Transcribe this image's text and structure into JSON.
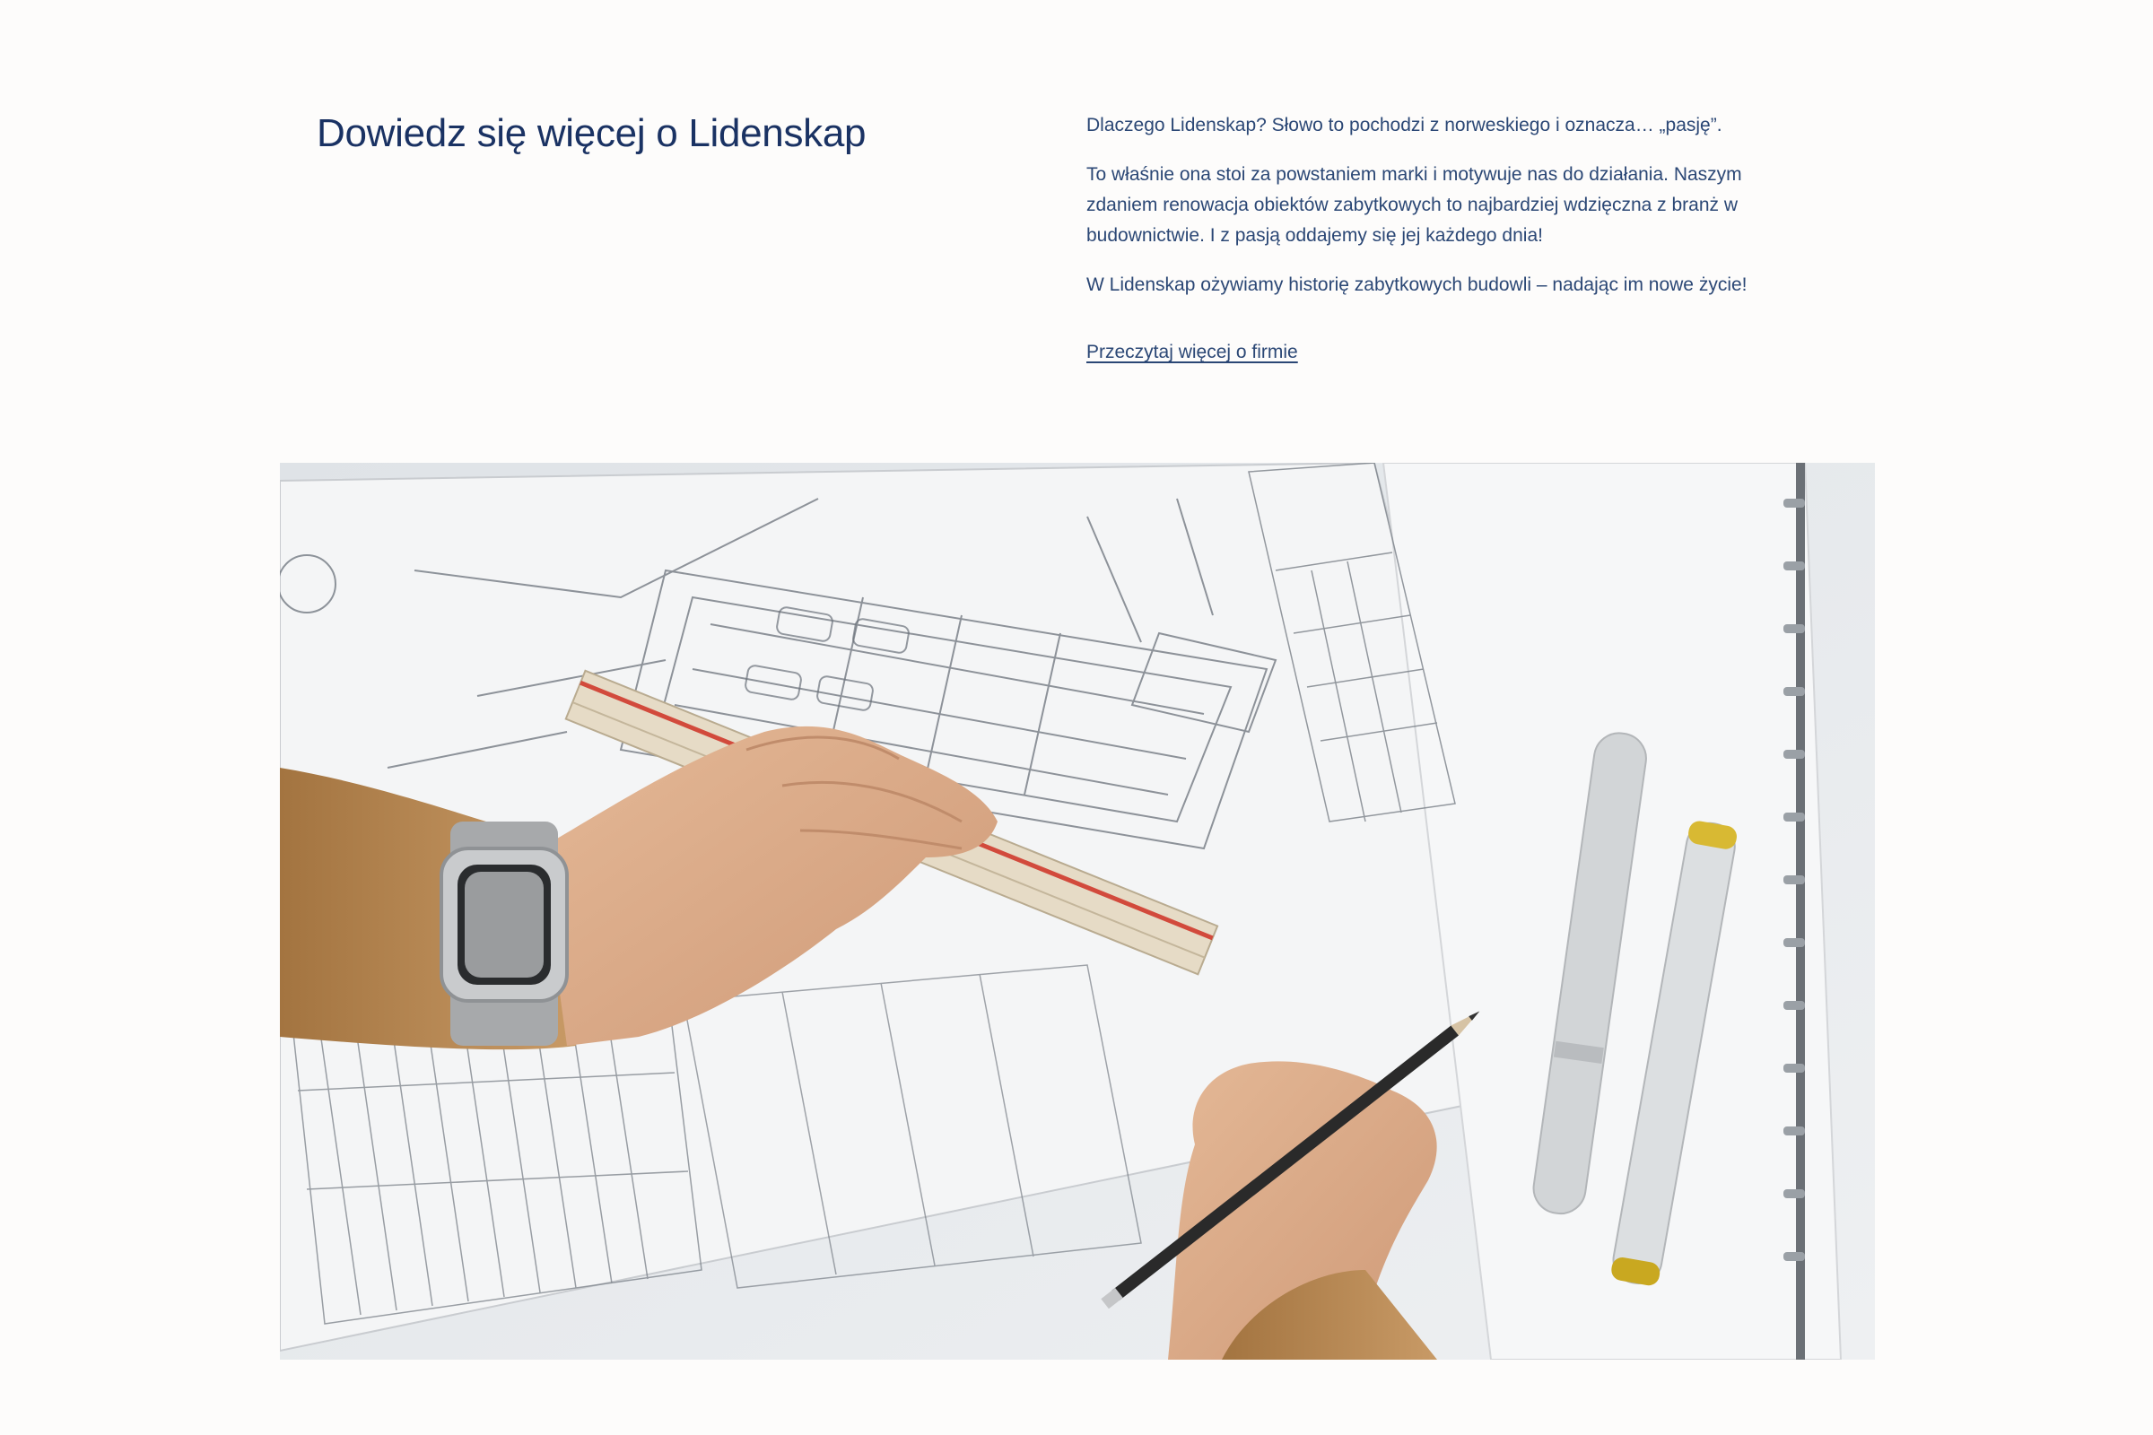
{
  "about": {
    "heading": "Dowiedz się więcej o Lidenskap",
    "paragraphs": [
      "Dlaczego Lidenskap? Słowo to pochodzi z norweskiego i oznacza… „pasję”.",
      "To właśnie ona stoi za powstaniem marki i motywuje nas do działania. Naszym zdaniem renowacja obiektów zabytkowych to najbardziej wdzięczna z branż w budownictwie. I z pasją oddajemy się jej każdego dnia!",
      "W Lidenskap ożywiamy historię zabytkowych budowli – nadając im nowe życie!"
    ],
    "link_label": "Przeczytaj więcej o firmie"
  },
  "photo": {
    "subject": "hands-drawing-blueprint-with-ruler-and-pencil"
  },
  "colors": {
    "background": "#fdfcfb",
    "heading": "#1a3263",
    "text": "#2b4775"
  }
}
